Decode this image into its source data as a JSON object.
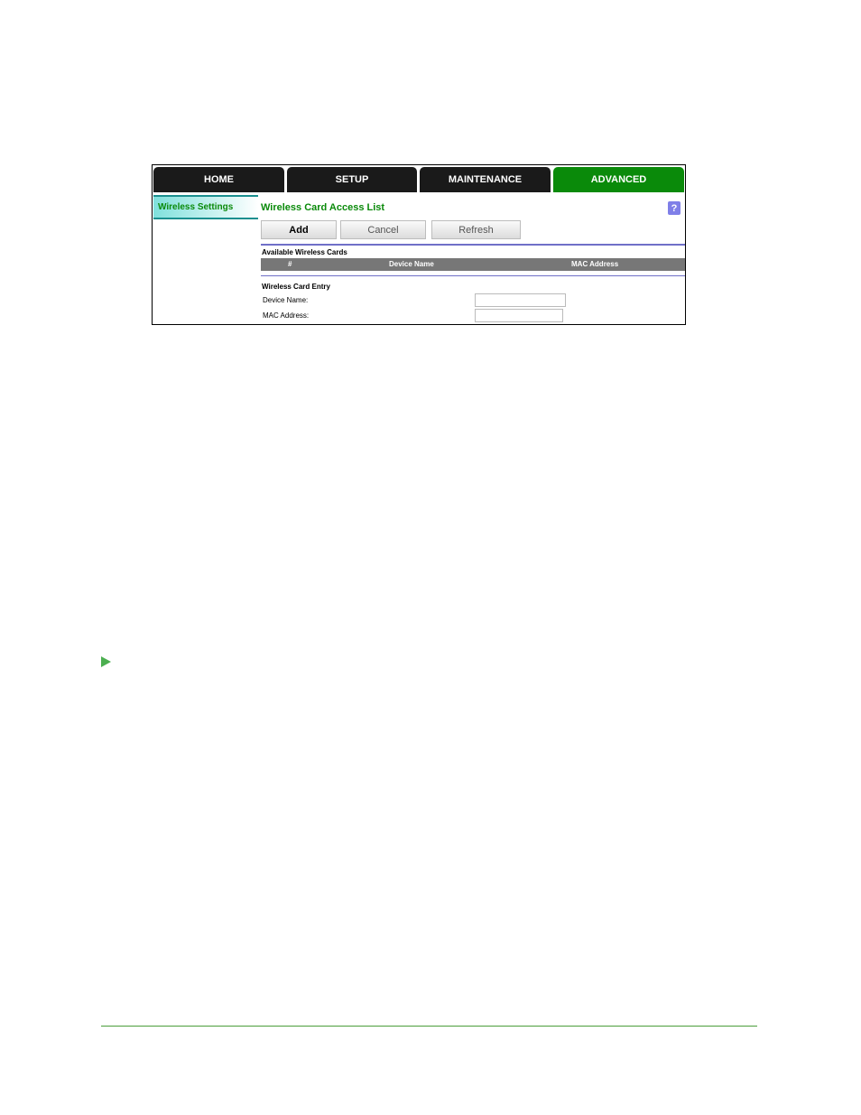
{
  "nav": {
    "tabs": [
      {
        "label": "HOME",
        "active": false
      },
      {
        "label": "SETUP",
        "active": false
      },
      {
        "label": "MAINTENANCE",
        "active": false
      },
      {
        "label": "ADVANCED",
        "active": true
      }
    ]
  },
  "sidebar": {
    "items": [
      {
        "label": "Wireless Settings",
        "active": true
      }
    ]
  },
  "main": {
    "title": "Wireless Card Access List",
    "help_icon": "question-mark-icon",
    "buttons": {
      "add": "Add",
      "cancel": "Cancel",
      "refresh": "Refresh"
    },
    "available_section": {
      "title": "Available Wireless Cards",
      "columns": [
        "#",
        "Device Name",
        "MAC Address"
      ],
      "rows": []
    },
    "entry_section": {
      "title": "Wireless Card Entry",
      "device_name_label": "Device Name:",
      "device_name_value": "",
      "mac_address_label": "MAC Address:",
      "mac_address_value": ""
    }
  },
  "colors": {
    "accent_green": "#0a8a0a",
    "tab_dark": "#1a1a1a",
    "divider_blue": "#7070c8",
    "table_header_gray": "#777777",
    "footer_green": "#4a9e3a"
  }
}
